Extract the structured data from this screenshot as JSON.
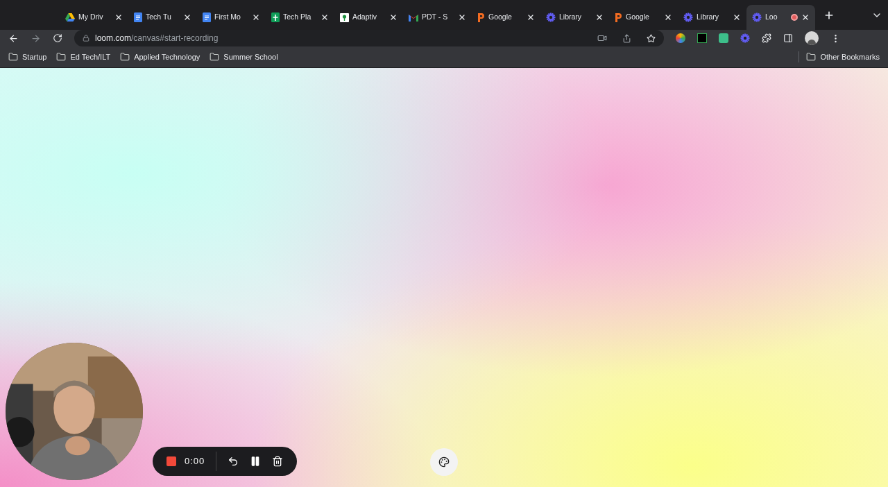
{
  "tabs": [
    {
      "title": "My Driv",
      "kind": "drive",
      "selected": false,
      "recording": false
    },
    {
      "title": "Tech Tu",
      "kind": "docs",
      "selected": false,
      "recording": false
    },
    {
      "title": "First Mo",
      "kind": "docs",
      "selected": false,
      "recording": false
    },
    {
      "title": "Tech Pla",
      "kind": "sheets",
      "selected": false,
      "recording": false
    },
    {
      "title": "Adaptiv",
      "kind": "pin",
      "selected": false,
      "recording": false
    },
    {
      "title": "PDT - S",
      "kind": "mail",
      "selected": false,
      "recording": false
    },
    {
      "title": "Google",
      "kind": "p",
      "selected": false,
      "recording": false
    },
    {
      "title": "Library",
      "kind": "loom",
      "selected": false,
      "recording": false
    },
    {
      "title": "Google",
      "kind": "p",
      "selected": false,
      "recording": false
    },
    {
      "title": "Library",
      "kind": "loom",
      "selected": false,
      "recording": false
    },
    {
      "title": "Loo",
      "kind": "loom",
      "selected": true,
      "recording": true
    }
  ],
  "address": {
    "host": "loom.com",
    "path": "/canvas#start-recording"
  },
  "bookmarks": [
    "Startup",
    "Ed Tech/ILT",
    "Applied Technology",
    "Summer School"
  ],
  "other_bookmarks": "Other Bookmarks",
  "recorder": {
    "time": "0:00"
  }
}
